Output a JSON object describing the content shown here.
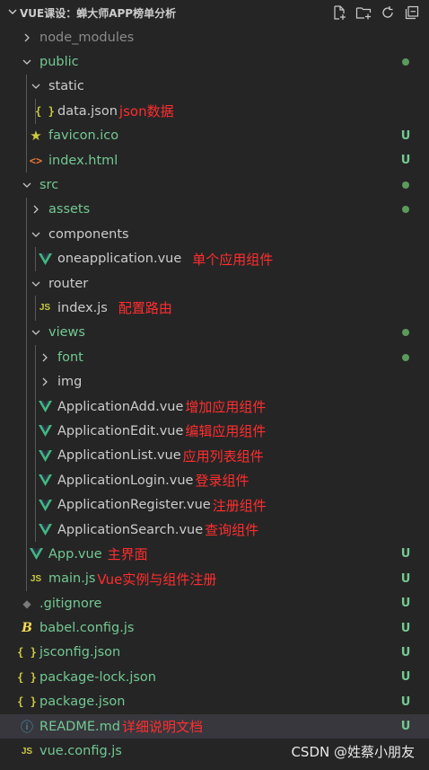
{
  "header": {
    "title": "VUE课设：蝉大师APP榜单分析"
  },
  "items": [
    {
      "name": "node_modules",
      "type": "folder",
      "depth": 0,
      "open": false,
      "color": "gray",
      "status": "",
      "dot": false,
      "note": ""
    },
    {
      "name": "public",
      "type": "folder",
      "depth": 0,
      "open": true,
      "color": "green",
      "status": "",
      "dot": true,
      "note": ""
    },
    {
      "name": "static",
      "type": "folder",
      "depth": 1,
      "open": true,
      "color": "white",
      "status": "",
      "dot": false,
      "note": ""
    },
    {
      "name": "data.json",
      "type": "json",
      "depth": 2,
      "color": "white",
      "status": "",
      "dot": false,
      "note": "json数据"
    },
    {
      "name": "favicon.ico",
      "type": "ico",
      "depth": 1,
      "color": "green",
      "status": "U",
      "dot": false,
      "note": ""
    },
    {
      "name": "index.html",
      "type": "html",
      "depth": 1,
      "color": "green",
      "status": "U",
      "dot": false,
      "note": ""
    },
    {
      "name": "src",
      "type": "folder",
      "depth": 0,
      "open": true,
      "color": "green",
      "status": "",
      "dot": true,
      "note": ""
    },
    {
      "name": "assets",
      "type": "folder",
      "depth": 1,
      "open": false,
      "color": "green",
      "status": "",
      "dot": true,
      "note": ""
    },
    {
      "name": "components",
      "type": "folder",
      "depth": 1,
      "open": true,
      "color": "white",
      "status": "",
      "dot": false,
      "note": ""
    },
    {
      "name": "oneapplication.vue",
      "type": "vue",
      "depth": 2,
      "color": "white",
      "status": "",
      "dot": false,
      "note": "单个应用组件"
    },
    {
      "name": "router",
      "type": "folder",
      "depth": 1,
      "open": true,
      "color": "white",
      "status": "",
      "dot": false,
      "note": ""
    },
    {
      "name": "index.js",
      "type": "js",
      "depth": 2,
      "color": "white",
      "status": "",
      "dot": false,
      "note": "配置路由"
    },
    {
      "name": "views",
      "type": "folder",
      "depth": 1,
      "open": true,
      "color": "green",
      "status": "",
      "dot": true,
      "note": ""
    },
    {
      "name": "font",
      "type": "folder",
      "depth": 2,
      "open": false,
      "color": "green",
      "status": "",
      "dot": true,
      "note": ""
    },
    {
      "name": "img",
      "type": "folder",
      "depth": 2,
      "open": false,
      "color": "white",
      "status": "",
      "dot": false,
      "note": ""
    },
    {
      "name": "ApplicationAdd.vue",
      "type": "vue",
      "depth": 2,
      "color": "white",
      "status": "",
      "dot": false,
      "note": "增加应用组件"
    },
    {
      "name": "ApplicationEdit.vue",
      "type": "vue",
      "depth": 2,
      "color": "white",
      "status": "",
      "dot": false,
      "note": "编辑应用组件"
    },
    {
      "name": "ApplicationList.vue",
      "type": "vue",
      "depth": 2,
      "color": "white",
      "status": "",
      "dot": false,
      "note": "应用列表组件"
    },
    {
      "name": "ApplicationLogin.vue",
      "type": "vue",
      "depth": 2,
      "color": "white",
      "status": "",
      "dot": false,
      "note": "登录组件"
    },
    {
      "name": "ApplicationRegister.vue",
      "type": "vue",
      "depth": 2,
      "color": "white",
      "status": "",
      "dot": false,
      "note": "注册组件"
    },
    {
      "name": "ApplicationSearch.vue",
      "type": "vue",
      "depth": 2,
      "color": "white",
      "status": "",
      "dot": false,
      "note": "查询组件"
    },
    {
      "name": "App.vue",
      "type": "vue",
      "depth": 1,
      "color": "green",
      "status": "U",
      "dot": false,
      "note": "主界面"
    },
    {
      "name": "main.js",
      "type": "js",
      "depth": 1,
      "color": "green",
      "status": "U",
      "dot": false,
      "note": "Vue实例与组件注册"
    },
    {
      "name": ".gitignore",
      "type": "git",
      "depth": 0,
      "color": "green",
      "status": "U",
      "dot": false,
      "note": ""
    },
    {
      "name": "babel.config.js",
      "type": "babel",
      "depth": 0,
      "color": "green",
      "status": "U",
      "dot": false,
      "note": ""
    },
    {
      "name": "jsconfig.json",
      "type": "json",
      "depth": 0,
      "color": "green",
      "status": "U",
      "dot": false,
      "note": ""
    },
    {
      "name": "package-lock.json",
      "type": "json",
      "depth": 0,
      "color": "green",
      "status": "U",
      "dot": false,
      "note": ""
    },
    {
      "name": "package.json",
      "type": "json",
      "depth": 0,
      "color": "green",
      "status": "U",
      "dot": false,
      "note": ""
    },
    {
      "name": "README.md",
      "type": "info",
      "depth": 0,
      "color": "green",
      "status": "U",
      "dot": false,
      "note": "详细说明文档",
      "selected": true
    },
    {
      "name": "vue.config.js",
      "type": "js",
      "depth": 0,
      "color": "green",
      "status": "",
      "dot": false,
      "note": ""
    }
  ],
  "watermark": "CSDN @姓蔡小朋友",
  "colors": {
    "background": "#252526",
    "untracked": "#73c991",
    "note": "#ff2e2e",
    "selected": "#37373d"
  },
  "icons": {
    "header_tools": [
      "new-file-icon",
      "new-folder-icon",
      "refresh-icon",
      "collapse-all-icon"
    ]
  }
}
